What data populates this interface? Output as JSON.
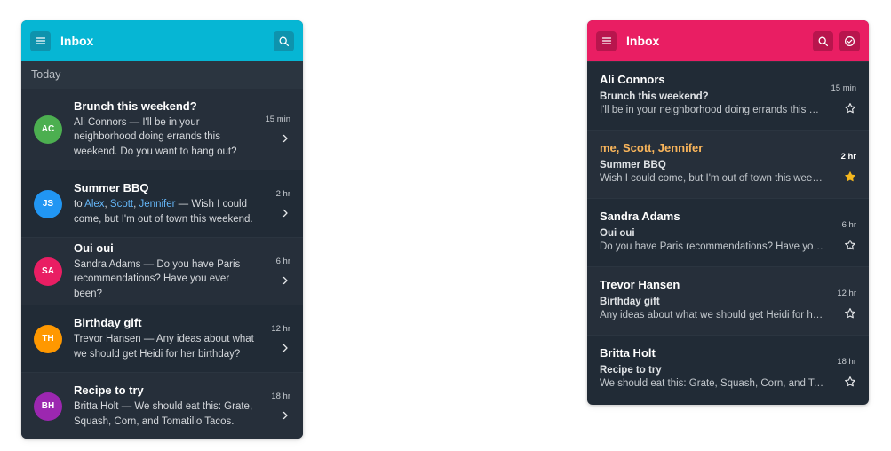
{
  "left": {
    "title": "Inbox",
    "section_label": "Today",
    "accent": "#06b6d4",
    "items": [
      {
        "initials": "AC",
        "color": "#4caf50",
        "title": "Brunch this weekend?",
        "sender": "Ali Connors",
        "to_prefix": "",
        "recipients": [],
        "body": "I'll be in your neighborhood doing errands this weekend. Do you want to hang out?",
        "time": "15 min"
      },
      {
        "initials": "JS",
        "color": "#2196f3",
        "title": "Summer BBQ",
        "sender": "",
        "to_prefix": "to",
        "recipients": [
          "Alex",
          "Scott",
          "Jennifer"
        ],
        "body": "Wish I could come, but I'm out of town this weekend.",
        "time": "2 hr"
      },
      {
        "initials": "SA",
        "color": "#e91e63",
        "title": "Oui oui",
        "sender": "Sandra Adams",
        "to_prefix": "",
        "recipients": [],
        "body": "Do you have Paris recommendations? Have you ever been?",
        "time": "6 hr"
      },
      {
        "initials": "TH",
        "color": "#ff9800",
        "title": "Birthday gift",
        "sender": "Trevor Hansen",
        "to_prefix": "",
        "recipients": [],
        "body": "Any ideas about what we should get Heidi for her birthday?",
        "time": "12 hr"
      },
      {
        "initials": "BH",
        "color": "#9c27b0",
        "title": "Recipe to try",
        "sender": "Britta Holt",
        "to_prefix": "",
        "recipients": [],
        "body": "We should eat this: Grate, Squash, Corn, and Tomatillo Tacos.",
        "time": "18 hr"
      }
    ]
  },
  "right": {
    "title": "Inbox",
    "accent": "#e91e63",
    "items": [
      {
        "name": "Ali Connors",
        "subject": "Brunch this weekend?",
        "preview": "I'll be in your neighborhood doing errands this weekend. Do you want to hang out?",
        "time": "15 min",
        "starred": false,
        "unread": false
      },
      {
        "name": "me, Scott, Jennifer",
        "subject": "Summer BBQ",
        "preview": "Wish I could come, but I'm out of town this weekend.",
        "time": "2 hr",
        "starred": true,
        "unread": true
      },
      {
        "name": "Sandra Adams",
        "subject": "Oui oui",
        "preview": "Do you have Paris recommendations? Have you ever been?",
        "time": "6 hr",
        "starred": false,
        "unread": false
      },
      {
        "name": "Trevor Hansen",
        "subject": "Birthday gift",
        "preview": "Any ideas about what we should get Heidi for her birthday?",
        "time": "12 hr",
        "starred": false,
        "unread": false
      },
      {
        "name": "Britta Holt",
        "subject": "Recipe to try",
        "preview": "We should eat this: Grate, Squash, Corn, and Tomatillo Tacos.",
        "time": "18 hr",
        "starred": false,
        "unread": false
      }
    ]
  },
  "icons": {
    "menu": "menu-icon",
    "search": "search-icon",
    "check": "check-circle-icon",
    "chevron": "chevron-right-icon",
    "star": "star-icon"
  },
  "colors": {
    "surface": "#212b36",
    "link": "#64b5f6",
    "highlight_name": "#f9b55b",
    "star_filled": "#f5b81e"
  }
}
